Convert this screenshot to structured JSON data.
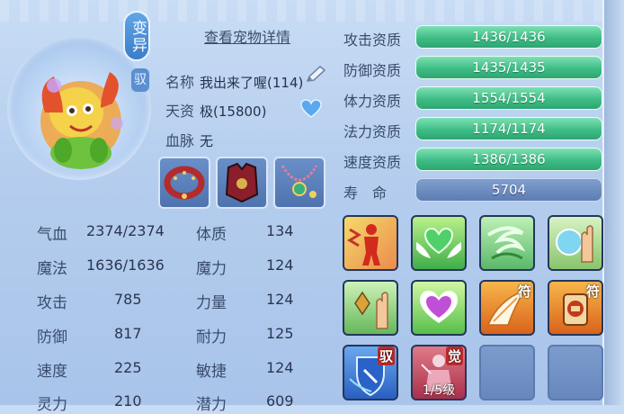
{
  "header": {
    "detail_link": "查看宠物详情",
    "mutant_badge": "变异",
    "small_badge": "驭"
  },
  "pet_info": {
    "name_label": "名称",
    "name_value": "我出来了喔(114)",
    "aptitude_label": "天资",
    "aptitude_value": "极(15800)",
    "bloodline_label": "血脉",
    "bloodline_value": "无"
  },
  "stats": [
    {
      "label": "气血",
      "value": "2374/2374"
    },
    {
      "label": "魔法",
      "value": "1636/1636"
    },
    {
      "label": "攻击",
      "value": "785"
    },
    {
      "label": "防御",
      "value": "817"
    },
    {
      "label": "速度",
      "value": "225"
    },
    {
      "label": "灵力",
      "value": "210"
    }
  ],
  "attributes": [
    {
      "label": "体质",
      "value": "134"
    },
    {
      "label": "魔力",
      "value": "124"
    },
    {
      "label": "力量",
      "value": "124"
    },
    {
      "label": "耐力",
      "value": "125"
    },
    {
      "label": "敏捷",
      "value": "124"
    },
    {
      "label": "潜力",
      "value": "609"
    }
  ],
  "qualities": [
    {
      "label": "攻击资质",
      "value": "1436/1436"
    },
    {
      "label": "防御资质",
      "value": "1435/1435"
    },
    {
      "label": "体力资质",
      "value": "1554/1554"
    },
    {
      "label": "法力资质",
      "value": "1174/1174"
    },
    {
      "label": "速度资质",
      "value": "1386/1386"
    }
  ],
  "lifespan": {
    "label": "寿　命",
    "value": "5704"
  },
  "skills": [
    {
      "icon": "red-figure-icon"
    },
    {
      "icon": "green-heart-wings-icon"
    },
    {
      "icon": "green-wind-icon"
    },
    {
      "icon": "palm-shield-icon"
    },
    {
      "icon": "hand-crystal-icon"
    },
    {
      "icon": "purple-heart-icon"
    },
    {
      "icon": "wing-talisman-icon",
      "tag": "符"
    },
    {
      "icon": "beast-talisman-icon",
      "tag": "符"
    },
    {
      "icon": "shield-drive-icon",
      "tag": "驭"
    },
    {
      "icon": "awaken-figure-icon",
      "tag": "觉",
      "level": "1/5级"
    }
  ]
}
